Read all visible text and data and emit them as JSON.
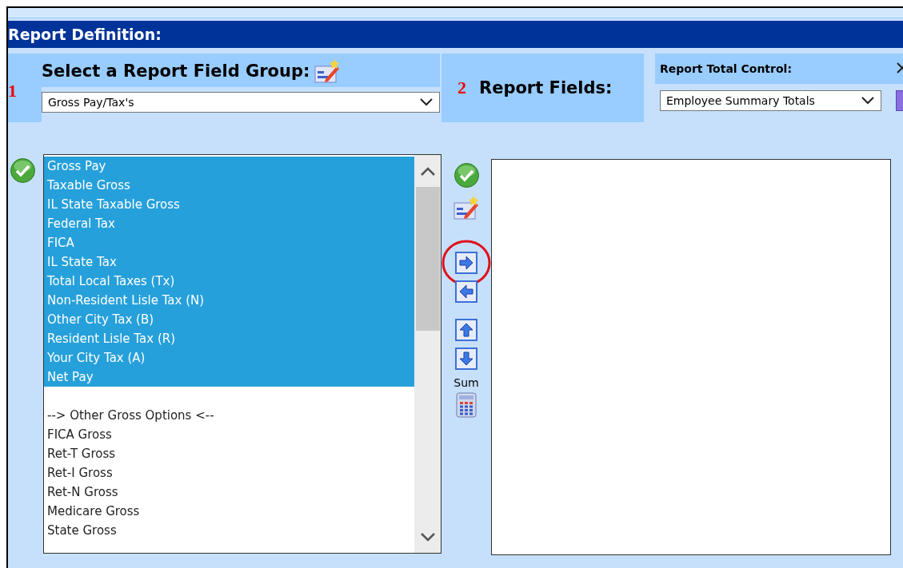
{
  "window": {
    "title": "Report Definition:"
  },
  "field_group": {
    "step": "1",
    "label": "Select a Report Field Group:",
    "value": "Gross Pay/Tax's"
  },
  "report_fields": {
    "step": "2",
    "label": "Report Fields:"
  },
  "total_control": {
    "label": "Report Total Control:",
    "value": "Employee Summary Totals"
  },
  "available_fields": [
    {
      "label": "Gross Pay",
      "kind": "option",
      "selected": true
    },
    {
      "label": "Taxable Gross",
      "kind": "option",
      "selected": true
    },
    {
      "label": "IL State Taxable Gross",
      "kind": "option",
      "selected": true
    },
    {
      "label": "Federal Tax",
      "kind": "option",
      "selected": true
    },
    {
      "label": "FICA",
      "kind": "option",
      "selected": true
    },
    {
      "label": "IL State Tax",
      "kind": "option",
      "selected": true
    },
    {
      "label": "Total Local Taxes (Tx)",
      "kind": "option",
      "selected": true
    },
    {
      "label": "Non-Resident Lisle Tax (N)",
      "kind": "option",
      "selected": true
    },
    {
      "label": "Other City Tax (B)",
      "kind": "option",
      "selected": true
    },
    {
      "label": "Resident Lisle Tax (R)",
      "kind": "option",
      "selected": true
    },
    {
      "label": "Your City Tax (A)",
      "kind": "option",
      "selected": true
    },
    {
      "label": "Net Pay",
      "kind": "option",
      "selected": true
    },
    {
      "label": "--> Other Gross Options <--",
      "kind": "group-heading",
      "selected": false
    },
    {
      "label": "FICA Gross",
      "kind": "option",
      "selected": false
    },
    {
      "label": "Ret-T Gross",
      "kind": "option",
      "selected": false
    },
    {
      "label": "Ret-I Gross",
      "kind": "option",
      "selected": false
    },
    {
      "label": "Ret-N Gross",
      "kind": "option",
      "selected": false
    },
    {
      "label": "Medicare Gross",
      "kind": "option",
      "selected": false
    },
    {
      "label": "State Gross",
      "kind": "option",
      "selected": false
    }
  ],
  "tools": [
    {
      "kind": "accept",
      "highlighted": false
    },
    {
      "kind": "edit",
      "highlighted": false
    },
    {
      "kind": "move-right",
      "highlighted": true
    },
    {
      "kind": "move-left",
      "highlighted": false
    },
    {
      "kind": "move-up",
      "highlighted": false
    },
    {
      "kind": "move-down",
      "highlighted": false
    },
    {
      "kind": "label",
      "text": "Sum",
      "highlighted": false
    },
    {
      "kind": "calculator",
      "highlighted": false
    }
  ]
}
